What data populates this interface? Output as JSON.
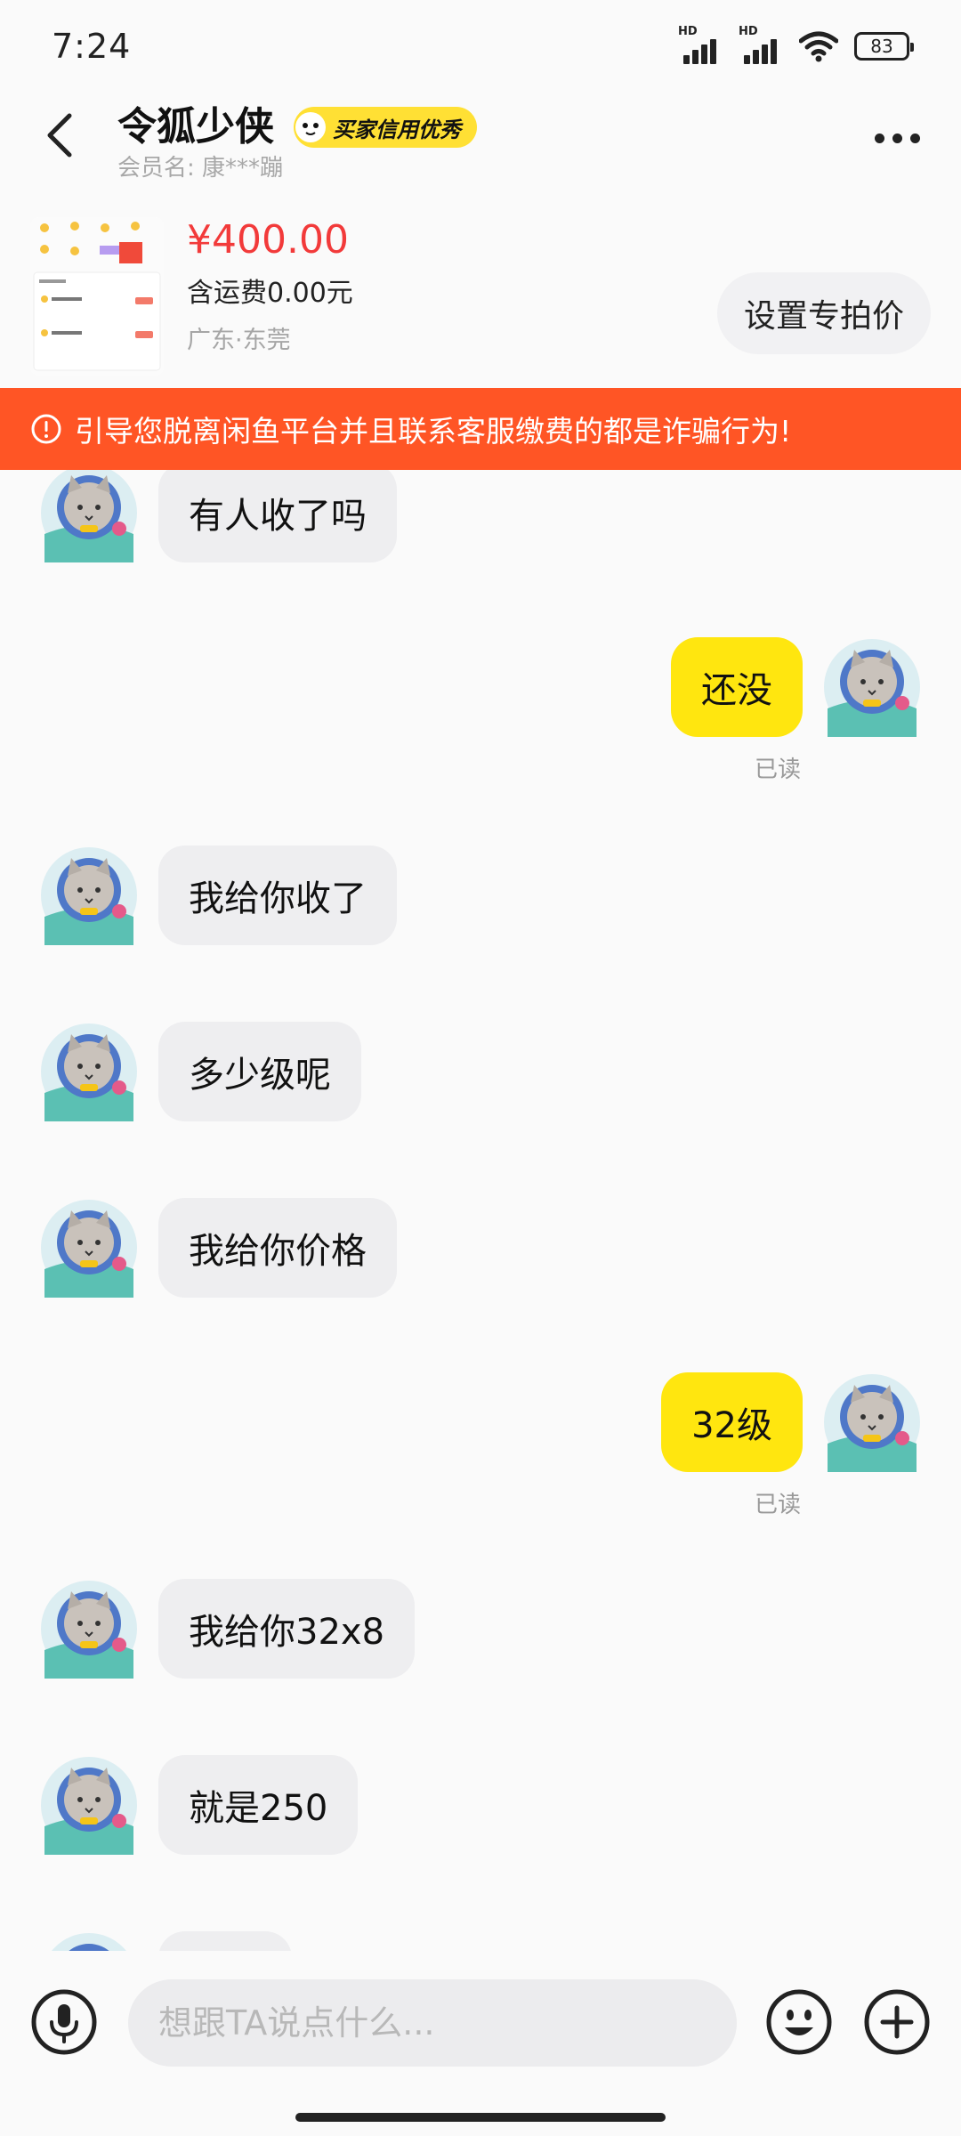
{
  "status_bar": {
    "time": "7:24",
    "sim1_label": "HD",
    "sim2_label": "HD",
    "battery": "83"
  },
  "header": {
    "title": "令狐少侠",
    "badge": "买家信用优秀",
    "member_label": "会员名:",
    "member_name": "康***蹦"
  },
  "product": {
    "price": "¥400.00",
    "shipping": "含运费0.00元",
    "location": "广东·东莞",
    "special_price_button": "设置专拍价"
  },
  "warning": {
    "text": "引导您脱离闲鱼平台并且联系客服缴费的都是诈骗行为!"
  },
  "messages": [
    {
      "side": "in",
      "text": "有人收了吗"
    },
    {
      "side": "out",
      "text": "还没",
      "status": "已读"
    },
    {
      "side": "in",
      "text": "我给你收了"
    },
    {
      "side": "in",
      "text": "多少级呢"
    },
    {
      "side": "in",
      "text": "我给你价格"
    },
    {
      "side": "out",
      "text": "32级",
      "status": "已读"
    },
    {
      "side": "in",
      "text": "我给你32x8"
    },
    {
      "side": "in",
      "text": "就是250"
    }
  ],
  "input": {
    "placeholder": "想跟TA说点什么..."
  },
  "colors": {
    "accent_yellow": "#ffe60f",
    "warning_orange": "#ff5525",
    "price_red": "#f23a3a"
  }
}
